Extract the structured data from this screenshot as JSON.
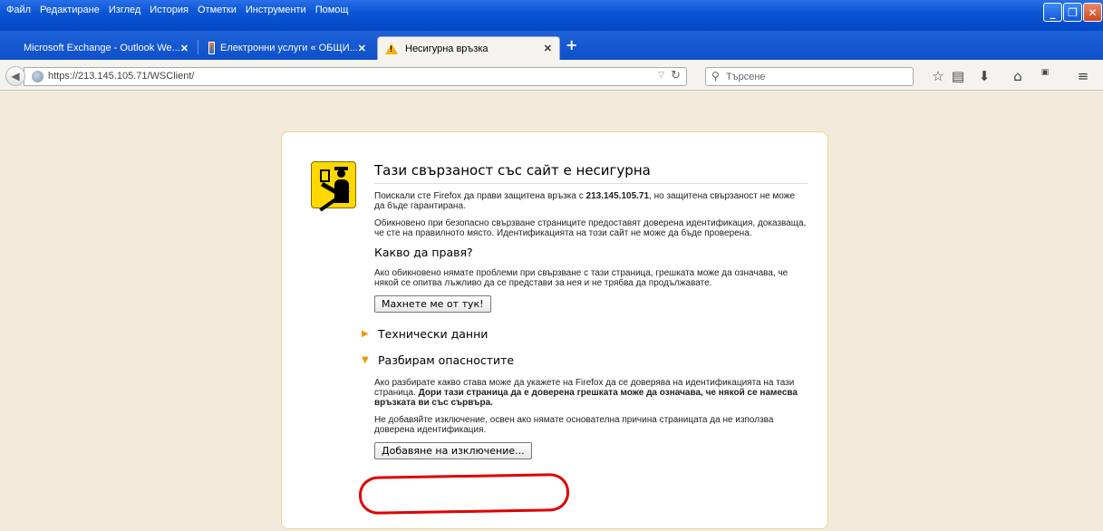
{
  "menu": [
    {
      "label": "Файл"
    },
    {
      "label": "Редактиране"
    },
    {
      "label": "Изглед"
    },
    {
      "label": "История"
    },
    {
      "label": "Отметки"
    },
    {
      "label": "Инструменти"
    },
    {
      "label": "Помощ"
    }
  ],
  "tabs": [
    {
      "label": "Microsoft Exchange - Outlook We...",
      "close": "✕"
    },
    {
      "label": "Електронни услуги « ОБЩИ...",
      "close": "✕"
    },
    {
      "label": "Несигурна връзка",
      "close": "✕"
    }
  ],
  "newtab": "+",
  "nav": {
    "url": "https://213.145.105.71/WSClient/",
    "search_placeholder": "Търсене"
  },
  "error": {
    "title": "Тази свързаност със сайт е несигурна",
    "p1_before": "Поискали сте Firefox да прави защитена връзка с ",
    "p1_host": "213.145.105.71",
    "p1_after": ", но защитена свързаност не може да бъде гарантирана.",
    "p2": "Обикновено при безопасно свързване страниците предоставят доверена идентификация, доказваща, че сте на правилното място. Идентификацията на този сайт не може да бъде проверена.",
    "what_heading": "Какво да правя?",
    "p3": "Ако обикновено нямате проблеми при свързване с тази страница, грешката може да означава, че някой се опитва лъжливо да се представи за нея и не трябва да продължавате.",
    "get_me_out": "Махнете ме от тук!",
    "tech_details": "Технически данни",
    "understand_risks": "Разбирам опасностите",
    "p4_before": "Ако разбирате какво става може да укажете на Firefox да се доверява на идентификацията на тази страница. ",
    "p4_bold": "Дори тази страница да е доверена грешката може да означава, че някой се намесва връзката ви със сървъра.",
    "p5": "Не добавяйте изключение, освен ако нямате основателна причина страницата да не използва доверена идентификация.",
    "add_exception": "Добавяне на изключение..."
  },
  "colors": {
    "window_blue": "#0447c6",
    "page_bg": "#f2ebdc",
    "card_border": "#eed58c",
    "badge_yellow": "#ffd800",
    "highlight": "#e00000"
  }
}
